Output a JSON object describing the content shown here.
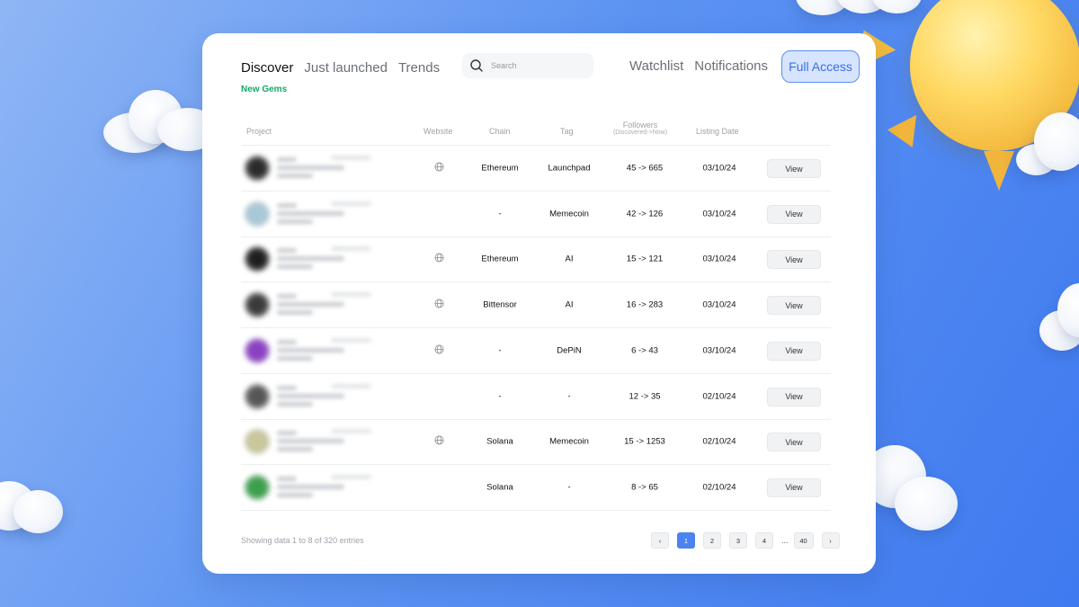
{
  "nav": {
    "discover": "Discover",
    "just_launched": "Just launched",
    "trends": "Trends",
    "sub": "New Gems",
    "search_placeholder": "Search",
    "watchlist": "Watchlist",
    "notifications": "Notifications",
    "full_access": "Full Access"
  },
  "table": {
    "headers": {
      "project": "Project",
      "website": "Website",
      "chain": "Chain",
      "tag": "Tag",
      "followers": "Followers",
      "followers_sub": "(Discovered->Now)",
      "listing_date": "Listing Date"
    },
    "rows": [
      {
        "chain": "Ethereum",
        "tag": "Launchpad",
        "followers": "45 -> 665",
        "date": "03/10/24",
        "action": "View",
        "website": true,
        "avatar_color": "#2b2b2b"
      },
      {
        "chain": "-",
        "tag": "Memecoin",
        "followers": "42 -> 126",
        "date": "03/10/24",
        "action": "View",
        "website": false,
        "avatar_color": "#a8c8d8"
      },
      {
        "chain": "Ethereum",
        "tag": "AI",
        "followers": "15 -> 121",
        "date": "03/10/24",
        "action": "View",
        "website": true,
        "avatar_color": "#1e1e1e"
      },
      {
        "chain": "Bittensor",
        "tag": "AI",
        "followers": "16 -> 283",
        "date": "03/10/24",
        "action": "View",
        "website": true,
        "avatar_color": "#3a3a3a"
      },
      {
        "chain": "-",
        "tag": "DePiN",
        "followers": "6 -> 43",
        "date": "03/10/24",
        "action": "View",
        "website": true,
        "avatar_color": "#8a3fc4"
      },
      {
        "chain": "-",
        "tag": "-",
        "followers": "12 -> 35",
        "date": "02/10/24",
        "action": "View",
        "website": false,
        "avatar_color": "#555555"
      },
      {
        "chain": "Solana",
        "tag": "Memecoin",
        "followers": "15 -> 1253",
        "date": "02/10/24",
        "action": "View",
        "website": true,
        "avatar_color": "#c9c79a"
      },
      {
        "chain": "Solana",
        "tag": "-",
        "followers": "8 -> 65",
        "date": "02/10/24",
        "action": "View",
        "website": false,
        "avatar_color": "#3aa04a"
      }
    ]
  },
  "footer": {
    "showing": "Showing data 1 to 8 of 320 entries",
    "pages": [
      "1",
      "2",
      "3",
      "4"
    ],
    "ellipsis": "...",
    "last_page": "40",
    "prev": "‹",
    "next": "›",
    "current_page": "1"
  }
}
